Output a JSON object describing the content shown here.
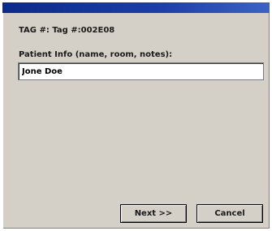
{
  "dialog": {
    "tag_line": "TAG #: Tag #:002E08",
    "field_label": "Patient Info (name, room, notes):",
    "field_value": "Jone Doe"
  },
  "buttons": {
    "next_label": "Next >>",
    "cancel_label": "Cancel"
  },
  "colors": {
    "titlebar": "#0b2a8a",
    "dialog_bg": "#d4d0c8"
  }
}
